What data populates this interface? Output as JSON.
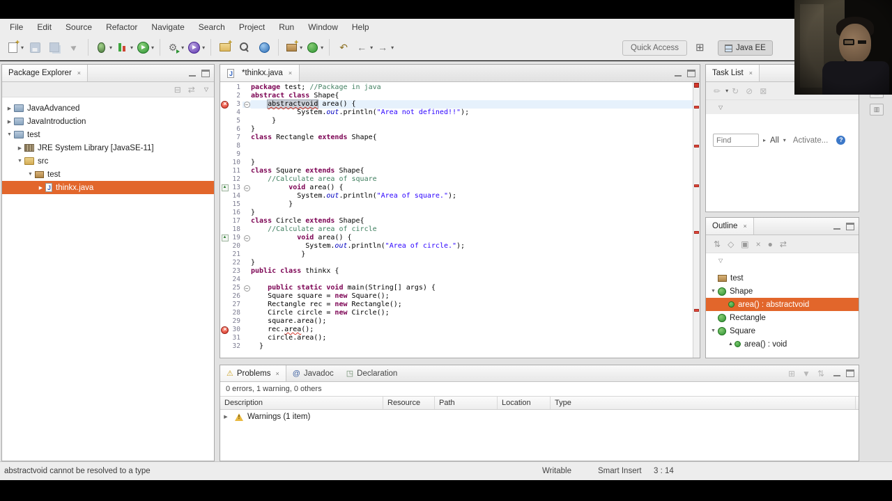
{
  "icons": {
    "close": "×",
    "dropdown": "▾",
    "view_menu": "▽",
    "tree_expanded": "▼",
    "tree_collapsed": "▶",
    "chevron": "▸",
    "help": "?"
  },
  "menu": {
    "items": [
      "File",
      "Edit",
      "Source",
      "Refactor",
      "Navigate",
      "Search",
      "Project",
      "Run",
      "Window",
      "Help"
    ]
  },
  "toolbar": {
    "quick_access": "Quick Access",
    "perspective_label": "Java EE",
    "icons": [
      {
        "name": "new-wizard",
        "kind": "new",
        "drop": true
      },
      {
        "name": "save",
        "kind": "save",
        "dim": true
      },
      {
        "name": "save-all",
        "kind": "save-all",
        "dim": true
      },
      {
        "name": "pointer",
        "kind": "pointer",
        "dim": true
      },
      {
        "name": "sep",
        "kind": "sep"
      },
      {
        "name": "debug",
        "kind": "debug",
        "drop": true
      },
      {
        "name": "coverage",
        "kind": "coverage",
        "drop": true
      },
      {
        "name": "run",
        "kind": "run",
        "drop": true
      },
      {
        "name": "sep",
        "kind": "sep"
      },
      {
        "name": "run-external-tools",
        "kind": "tools",
        "drop": true
      },
      {
        "name": "profile",
        "kind": "profile",
        "drop": true
      },
      {
        "name": "sep",
        "kind": "sep"
      },
      {
        "name": "new-java-project",
        "kind": "folder"
      },
      {
        "name": "search",
        "kind": "search"
      },
      {
        "name": "open-web-browser",
        "kind": "globe"
      },
      {
        "name": "sep",
        "kind": "sep"
      },
      {
        "name": "new-package",
        "kind": "package",
        "drop": true
      },
      {
        "name": "new-class",
        "kind": "class",
        "drop": true
      },
      {
        "name": "sep",
        "kind": "sep"
      },
      {
        "name": "last-edit-location",
        "kind": "last-edit"
      },
      {
        "name": "back",
        "kind": "back",
        "drop": true
      },
      {
        "name": "forward",
        "kind": "forward",
        "drop": true
      }
    ]
  },
  "package_explorer": {
    "title": "Package Explorer",
    "toolbar_icons": [
      {
        "name": "collapse-all",
        "glyph": "⊟"
      },
      {
        "name": "link-with-editor",
        "glyph": "⇄"
      }
    ],
    "items": [
      {
        "label": "JavaAdvanced",
        "icon": "project",
        "arrow": "collapsed",
        "level": 0
      },
      {
        "label": "JavaIntroduction",
        "icon": "project",
        "arrow": "collapsed",
        "level": 0
      },
      {
        "label": "test",
        "icon": "project",
        "arrow": "expanded",
        "level": 0
      },
      {
        "label": "JRE System Library [JavaSE-11]",
        "icon": "library",
        "arrow": "collapsed",
        "level": 1
      },
      {
        "label": "src",
        "icon": "srcfolder",
        "arrow": "expanded",
        "level": 1
      },
      {
        "label": "test",
        "icon": "package",
        "arrow": "expanded",
        "level": 2
      },
      {
        "label": "thinkx.java",
        "icon": "jfile",
        "arrow": "collapsed",
        "level": 3,
        "selected": true
      }
    ]
  },
  "editor": {
    "tab_label": "*thinkx.java",
    "ruler_marks": [
      3,
      8,
      13,
      19,
      29
    ],
    "lines": [
      {
        "n": 1,
        "tokens": [
          {
            "t": "k",
            "v": "package"
          },
          {
            "t": "p",
            "v": " test; "
          },
          {
            "t": "c",
            "v": "//Package in java"
          }
        ]
      },
      {
        "n": 2,
        "tokens": [
          {
            "t": "k",
            "v": "abstract class"
          },
          {
            "t": "p",
            "v": " Shape{"
          }
        ]
      },
      {
        "n": 3,
        "hl": true,
        "marker": "error",
        "fold": true,
        "tokens": [
          {
            "t": "p",
            "v": "    "
          },
          {
            "t": "x",
            "v": "abstractvoid"
          },
          {
            "t": "p",
            "v": " area() {"
          }
        ]
      },
      {
        "n": 4,
        "tokens": [
          {
            "t": "p",
            "v": "           System."
          },
          {
            "t": "f",
            "v": "out"
          },
          {
            "t": "p",
            "v": ".println("
          },
          {
            "t": "s",
            "v": "\"Area not defined!!\""
          },
          {
            "t": "p",
            "v": ");"
          }
        ]
      },
      {
        "n": 5,
        "tokens": [
          {
            "t": "p",
            "v": "     }"
          }
        ]
      },
      {
        "n": 6,
        "tokens": [
          {
            "t": "p",
            "v": "}"
          }
        ]
      },
      {
        "n": 7,
        "tokens": [
          {
            "t": "k",
            "v": "class"
          },
          {
            "t": "p",
            "v": " Rectangle "
          },
          {
            "t": "k",
            "v": "extends"
          },
          {
            "t": "p",
            "v": " Shape{"
          }
        ]
      },
      {
        "n": 8,
        "tokens": []
      },
      {
        "n": 9,
        "tokens": []
      },
      {
        "n": 10,
        "tokens": [
          {
            "t": "p",
            "v": "}"
          }
        ]
      },
      {
        "n": 11,
        "tokens": [
          {
            "t": "k",
            "v": "class"
          },
          {
            "t": "p",
            "v": " Square "
          },
          {
            "t": "k",
            "v": "extends"
          },
          {
            "t": "p",
            "v": " Shape{"
          }
        ]
      },
      {
        "n": 12,
        "tokens": [
          {
            "t": "p",
            "v": "    "
          },
          {
            "t": "c",
            "v": "//Calculate area of square"
          }
        ]
      },
      {
        "n": 13,
        "marker": "override",
        "fold": true,
        "tokens": [
          {
            "t": "p",
            "v": "         "
          },
          {
            "t": "k",
            "v": "void"
          },
          {
            "t": "p",
            "v": " area() {"
          }
        ]
      },
      {
        "n": 14,
        "tokens": [
          {
            "t": "p",
            "v": "           System."
          },
          {
            "t": "f",
            "v": "out"
          },
          {
            "t": "p",
            "v": ".println("
          },
          {
            "t": "s",
            "v": "\"Area of square.\""
          },
          {
            "t": "p",
            "v": ");"
          }
        ]
      },
      {
        "n": 15,
        "tokens": [
          {
            "t": "p",
            "v": "         }"
          }
        ]
      },
      {
        "n": 16,
        "tokens": [
          {
            "t": "p",
            "v": "}"
          }
        ]
      },
      {
        "n": 17,
        "tokens": [
          {
            "t": "k",
            "v": "class"
          },
          {
            "t": "p",
            "v": " Circle "
          },
          {
            "t": "k",
            "v": "extends"
          },
          {
            "t": "p",
            "v": " Shape{"
          }
        ]
      },
      {
        "n": 18,
        "tokens": [
          {
            "t": "p",
            "v": "    "
          },
          {
            "t": "c",
            "v": "//Calculate area of circle"
          }
        ]
      },
      {
        "n": 19,
        "marker": "override",
        "fold": true,
        "tokens": [
          {
            "t": "p",
            "v": "           "
          },
          {
            "t": "k",
            "v": "void"
          },
          {
            "t": "p",
            "v": " area() {"
          }
        ]
      },
      {
        "n": 20,
        "tokens": [
          {
            "t": "p",
            "v": "             System."
          },
          {
            "t": "f",
            "v": "out"
          },
          {
            "t": "p",
            "v": ".println("
          },
          {
            "t": "s",
            "v": "\"Area of circle.\""
          },
          {
            "t": "p",
            "v": ");"
          }
        ]
      },
      {
        "n": 21,
        "tokens": [
          {
            "t": "p",
            "v": "            }"
          }
        ]
      },
      {
        "n": 22,
        "tokens": [
          {
            "t": "p",
            "v": "}"
          }
        ]
      },
      {
        "n": 23,
        "tokens": [
          {
            "t": "k",
            "v": "public class"
          },
          {
            "t": "p",
            "v": " thinkx {"
          }
        ]
      },
      {
        "n": 24,
        "tokens": []
      },
      {
        "n": 25,
        "fold": true,
        "tokens": [
          {
            "t": "p",
            "v": "    "
          },
          {
            "t": "k",
            "v": "public static void"
          },
          {
            "t": "p",
            "v": " main(String[] args) {"
          }
        ]
      },
      {
        "n": 26,
        "tokens": [
          {
            "t": "p",
            "v": "    Square square = "
          },
          {
            "t": "k",
            "v": "new"
          },
          {
            "t": "p",
            "v": " Square();"
          }
        ]
      },
      {
        "n": 27,
        "tokens": [
          {
            "t": "p",
            "v": "    Rectangle rec = "
          },
          {
            "t": "k",
            "v": "new"
          },
          {
            "t": "p",
            "v": " Rectangle();"
          }
        ]
      },
      {
        "n": 28,
        "tokens": [
          {
            "t": "p",
            "v": "    Circle circle = "
          },
          {
            "t": "k",
            "v": "new"
          },
          {
            "t": "p",
            "v": " Circle();"
          }
        ]
      },
      {
        "n": 29,
        "tokens": [
          {
            "t": "p",
            "v": "    square.area();"
          }
        ]
      },
      {
        "n": 30,
        "marker": "error",
        "tokens": [
          {
            "t": "p",
            "v": "    rec."
          },
          {
            "t": "e",
            "v": "area"
          },
          {
            "t": "p",
            "v": "();"
          }
        ]
      },
      {
        "n": 31,
        "tokens": [
          {
            "t": "p",
            "v": "    circle.area();"
          }
        ]
      },
      {
        "n": 32,
        "tokens": [
          {
            "t": "p",
            "v": "  }"
          }
        ]
      }
    ]
  },
  "task_list": {
    "title": "Task List",
    "toolbar_icons": [
      {
        "name": "new-task",
        "glyph": "✏",
        "drop": true
      },
      {
        "name": "synchronize",
        "glyph": "↻"
      },
      {
        "name": "hide-query",
        "glyph": "⊘"
      },
      {
        "name": "remove-task",
        "glyph": "⊠"
      }
    ],
    "find_placeholder": "Find",
    "all_label": "All",
    "activate_label": "Activate..."
  },
  "outline": {
    "title": "Outline",
    "toolbar_icons": [
      {
        "name": "sort",
        "glyph": "⇅"
      },
      {
        "name": "hide-fields",
        "glyph": "◇"
      },
      {
        "name": "hide-static-members",
        "glyph": "▣"
      },
      {
        "name": "hide-non-public",
        "glyph": "×"
      },
      {
        "name": "hide-local-types",
        "glyph": "●"
      },
      {
        "name": "link-with-editor",
        "glyph": "⇄"
      }
    ],
    "items": [
      {
        "label": "test",
        "icon": "package",
        "level": 0
      },
      {
        "label": "Shape",
        "icon": "class",
        "arrow": "expanded",
        "level": 0
      },
      {
        "label": "area() : abstractvoid",
        "icon": "method",
        "level": 1,
        "selected": true
      },
      {
        "label": "Rectangle",
        "icon": "class",
        "level": 0
      },
      {
        "label": "Square",
        "icon": "class",
        "arrow": "expanded",
        "level": 0
      },
      {
        "label": "area() : void",
        "icon": "method",
        "level": 1,
        "override": true
      }
    ]
  },
  "problems": {
    "tabs": [
      {
        "label": "Problems",
        "glyph": "⚠",
        "selected": true
      },
      {
        "label": "Javadoc",
        "glyph": "@"
      },
      {
        "label": "Declaration",
        "glyph": "◳"
      }
    ],
    "toolbar_icons": [
      {
        "name": "group-by",
        "glyph": "⊞"
      },
      {
        "name": "filters",
        "glyph": "▼"
      },
      {
        "name": "focus-on-active-task",
        "glyph": "⇅"
      }
    ],
    "summary": "0 errors, 1 warning, 0 others",
    "columns": [
      "Description",
      "Resource",
      "Path",
      "Location",
      "Type"
    ],
    "groups": [
      {
        "label": "Warnings (1 item)"
      }
    ]
  },
  "right_strip": {
    "icons": [
      {
        "name": "minimized-view-1",
        "glyph": "▤"
      },
      {
        "name": "minimized-view-2",
        "glyph": "▥"
      }
    ]
  },
  "status_bar": {
    "message": "abstractvoid cannot be resolved to a type",
    "writable": "Writable",
    "insert_mode": "Smart Insert",
    "caret_position": "3 : 14"
  }
}
